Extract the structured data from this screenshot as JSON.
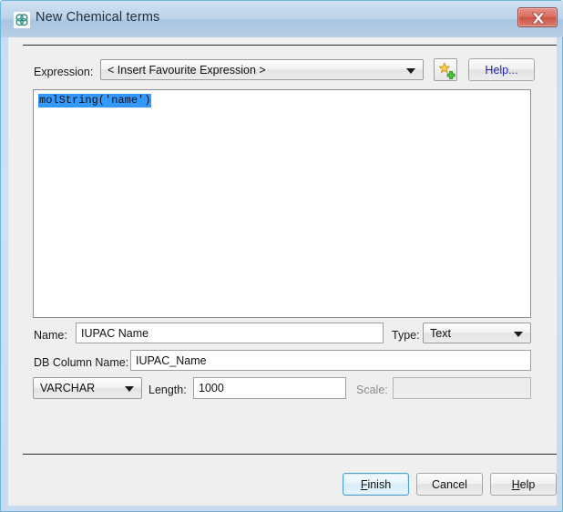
{
  "window": {
    "title": "New Chemical terms",
    "icon": "molecule-icon",
    "close_label": "✕"
  },
  "expression_row": {
    "label": "Expression:",
    "combo_value": "< Insert Favourite Expression >",
    "add_favourite_icon": "star-plus-icon",
    "help_button": "Help..."
  },
  "editor": {
    "code": "molString('name')",
    "selection_color": "#3399ff"
  },
  "name_row": {
    "label": "Name:",
    "value": "IUPAC Name",
    "type_label": "Type:",
    "type_value": "Text"
  },
  "db_column_row": {
    "label": "DB Column Name:",
    "value": "IUPAC_Name"
  },
  "sql_row": {
    "datatype_value": "VARCHAR",
    "length_label": "Length:",
    "length_value": "1000",
    "scale_label": "Scale:",
    "scale_value": ""
  },
  "footer": {
    "finish": {
      "pre": "",
      "mnemonic": "F",
      "post": "inish"
    },
    "cancel": {
      "pre": "Cancel",
      "mnemonic": "",
      "post": ""
    },
    "help": {
      "pre": "",
      "mnemonic": "H",
      "post": "elp"
    }
  },
  "colors": {
    "window_frame": "#cfdff0",
    "content_bg": "#efefef",
    "close_button": "#cc5345",
    "default_button_border": "#4a9fd0",
    "help_link_text": "#2222aa",
    "disabled_text": "#8a8a8a"
  }
}
